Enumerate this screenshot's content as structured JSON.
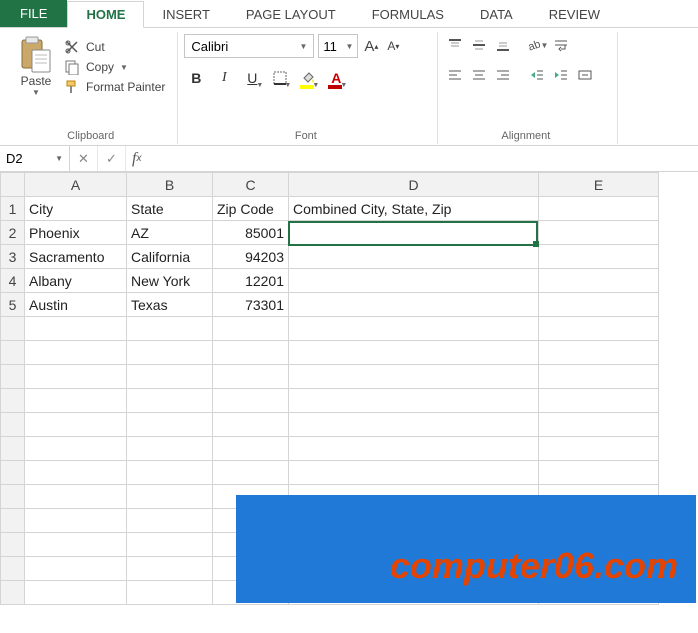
{
  "tabs": {
    "file": "FILE",
    "home": "HOME",
    "insert": "INSERT",
    "page_layout": "PAGE LAYOUT",
    "formulas": "FORMULAS",
    "data": "DATA",
    "review": "REVIEW"
  },
  "ribbon": {
    "clipboard": {
      "paste": "Paste",
      "cut": "Cut",
      "copy": "Copy",
      "format_painter": "Format Painter",
      "group_label": "Clipboard"
    },
    "font": {
      "name": "Calibri",
      "size": "11",
      "group_label": "Font",
      "bold": "B",
      "italic": "I",
      "underline": "U",
      "grow": "A",
      "shrink": "A"
    },
    "alignment": {
      "group_label": "Alignment"
    }
  },
  "name_box": "D2",
  "formula_bar": "",
  "columns": [
    "A",
    "B",
    "C",
    "D",
    "E"
  ],
  "rows": {
    "1": {
      "A": "City",
      "B": "State",
      "C": "Zip Code",
      "D": "Combined City, State, Zip",
      "E": ""
    },
    "2": {
      "A": "Phoenix",
      "B": "AZ",
      "C": "85001",
      "D": "",
      "E": ""
    },
    "3": {
      "A": "Sacramento",
      "B": "California",
      "C": "94203",
      "D": "",
      "E": ""
    },
    "4": {
      "A": "Albany",
      "B": "New York",
      "C": "12201",
      "D": "",
      "E": ""
    },
    "5": {
      "A": "Austin",
      "B": "Texas",
      "C": "73301",
      "D": "",
      "E": ""
    }
  },
  "active_cell": "D2",
  "watermark": "computer06.com"
}
